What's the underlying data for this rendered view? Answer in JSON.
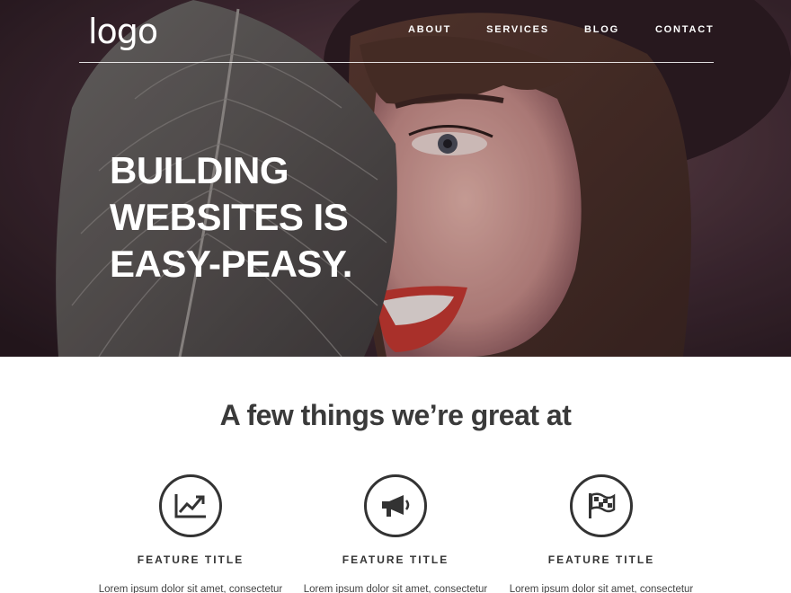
{
  "brand": {
    "logo": "logo"
  },
  "nav": {
    "items": [
      {
        "label": "ABOUT"
      },
      {
        "label": "SERVICES"
      },
      {
        "label": "BLOG"
      },
      {
        "label": "CONTACT"
      }
    ]
  },
  "hero": {
    "headline_lines": [
      "BUILDING",
      "WEBSITES IS",
      "EASY-PEASY."
    ],
    "image": "woman-holding-leaf-photo"
  },
  "features": {
    "heading": "A few things we’re great at",
    "items": [
      {
        "icon": "chart-trend-icon",
        "title": "FEATURE TITLE",
        "text": "Lorem ipsum dolor sit amet, consectetur"
      },
      {
        "icon": "megaphone-icon",
        "title": "FEATURE TITLE",
        "text": "Lorem ipsum dolor sit amet, consectetur"
      },
      {
        "icon": "flag-icon",
        "title": "FEATURE TITLE",
        "text": "Lorem ipsum dolor sit amet, consectetur"
      }
    ]
  },
  "colors": {
    "text": "#333333",
    "hero_overlay": "#3a2630",
    "white": "#ffffff"
  }
}
